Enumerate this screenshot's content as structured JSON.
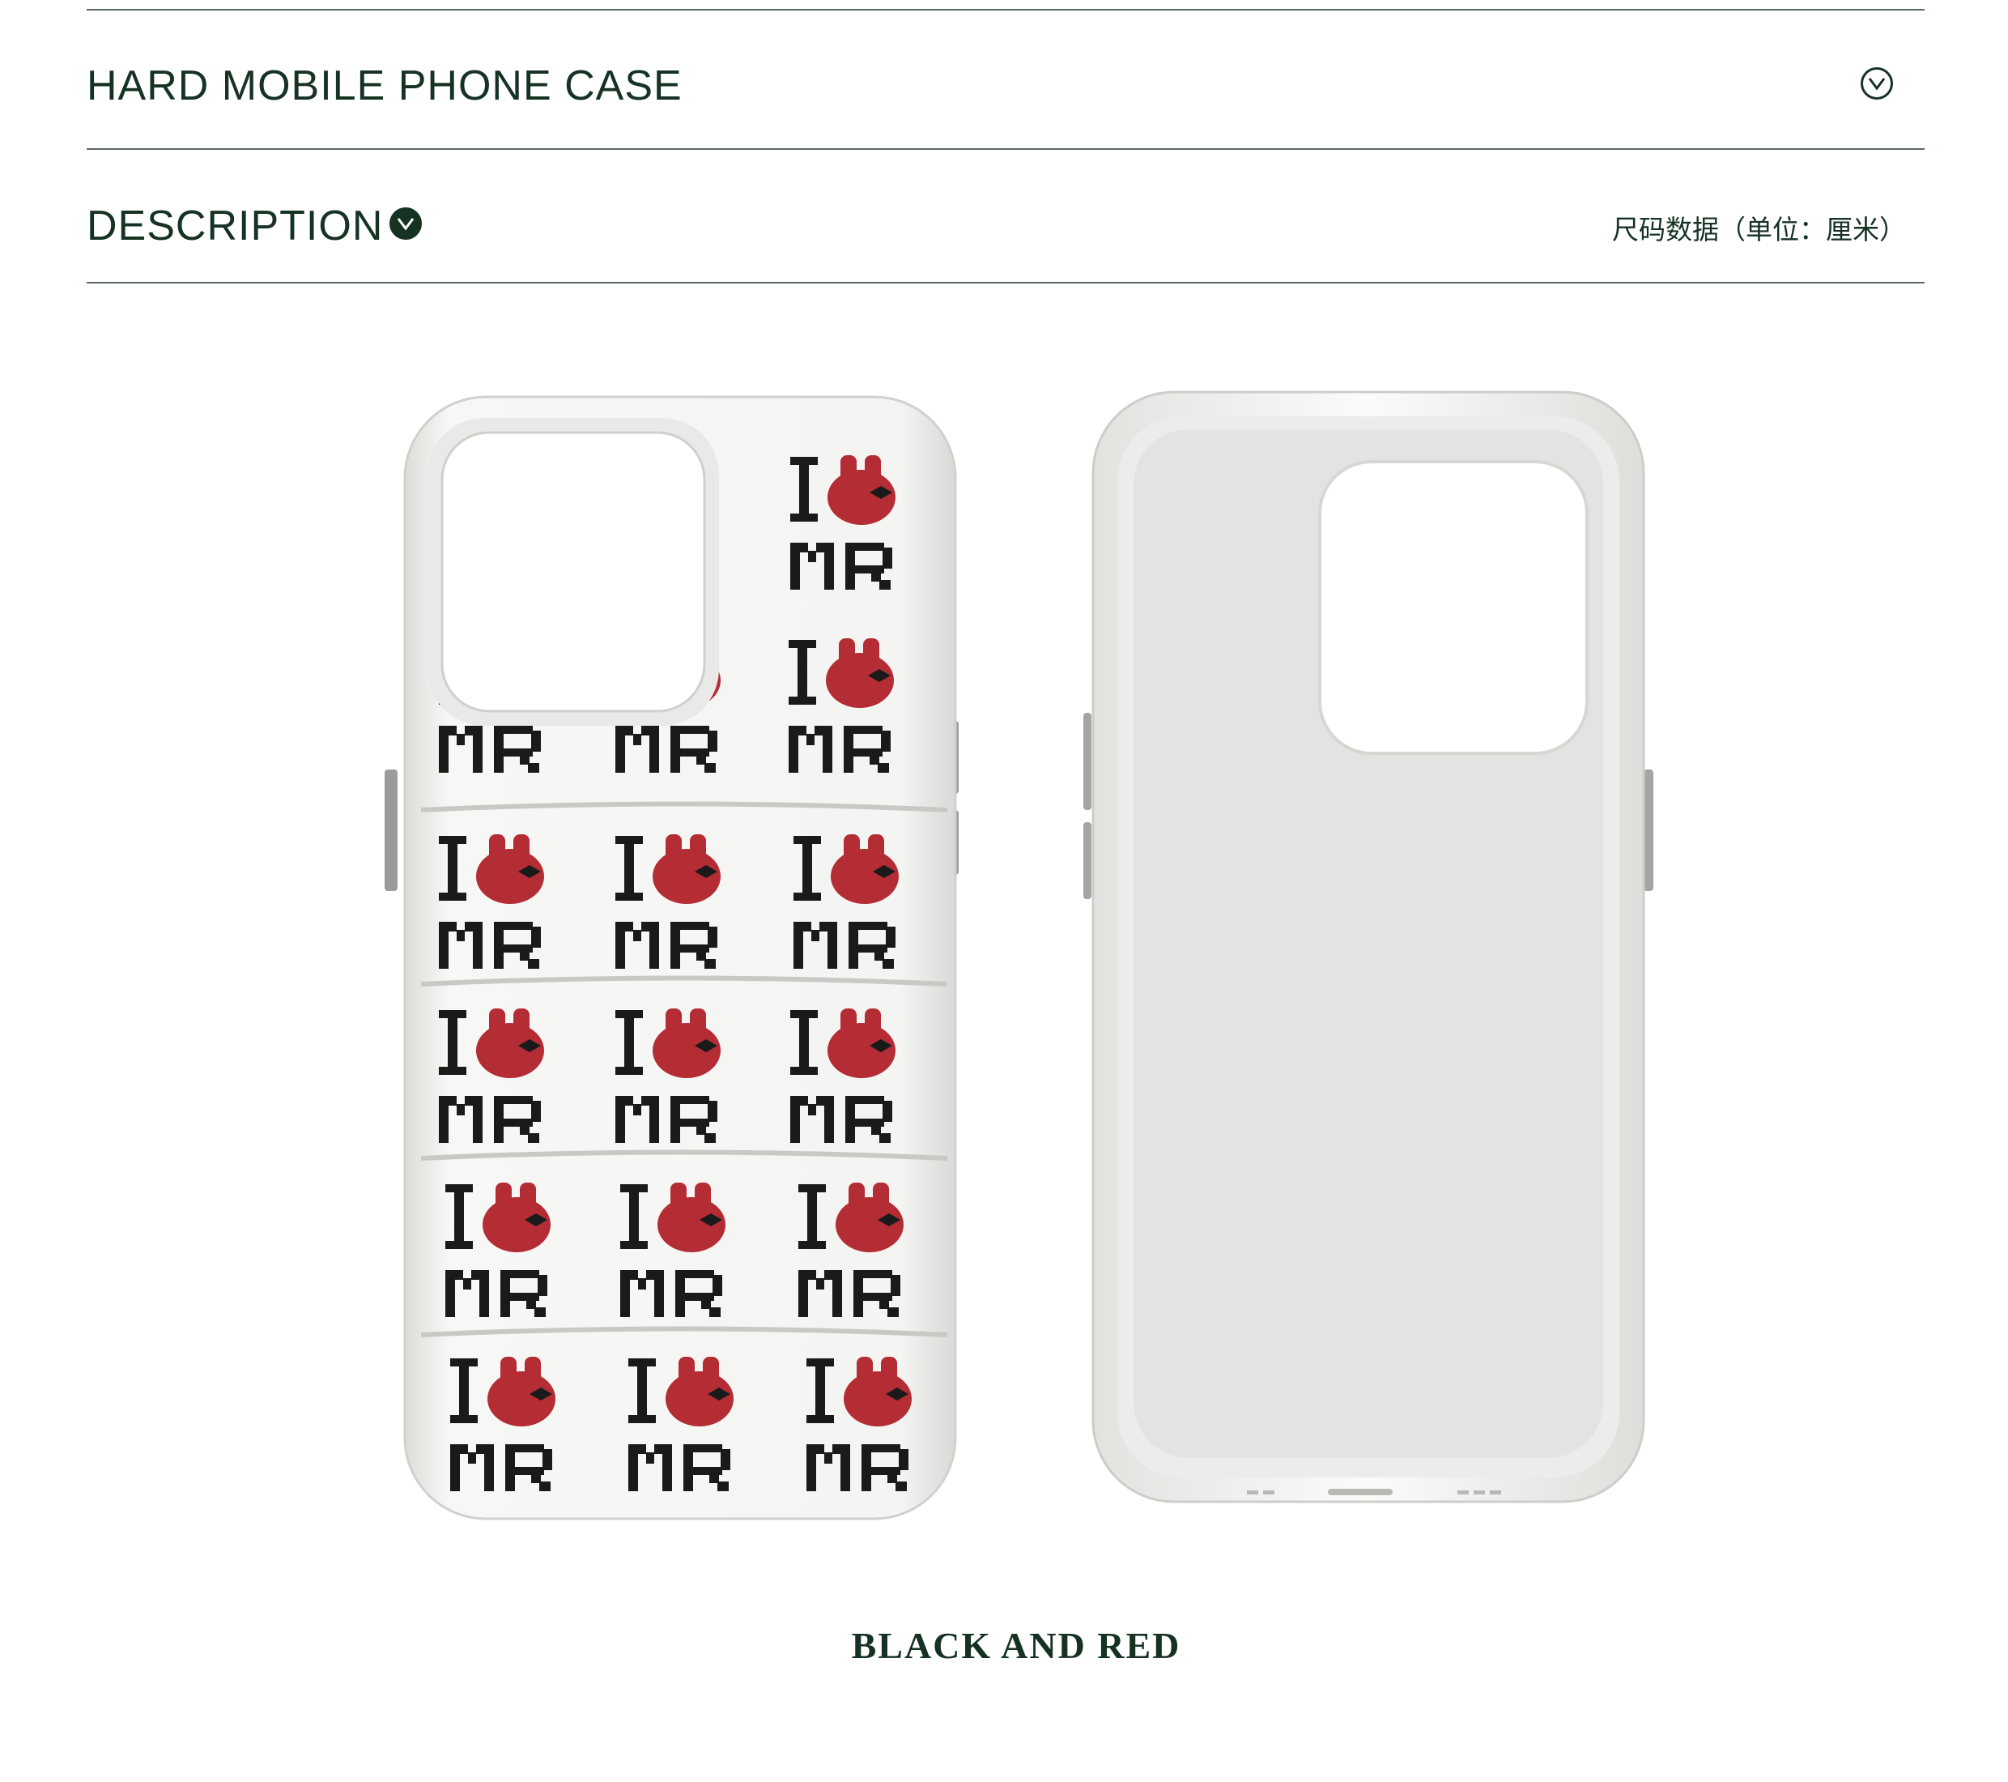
{
  "section_hard_case": {
    "title": "HARD MOBILE PHONE CASE",
    "toggle_icon": "chevron-down-circle-outline-icon"
  },
  "section_description": {
    "title": "DESCRIPTION",
    "toggle_icon": "chevron-down-circle-filled-icon",
    "size_link": "尺码数据（单位：厘米）"
  },
  "product_image": {
    "pattern": {
      "line1": "I",
      "line2": "MR"
    },
    "colors": {
      "accent": "#163223",
      "red": "#b42c34",
      "case": "#f2f2f0"
    }
  },
  "caption": "BLACK AND RED"
}
